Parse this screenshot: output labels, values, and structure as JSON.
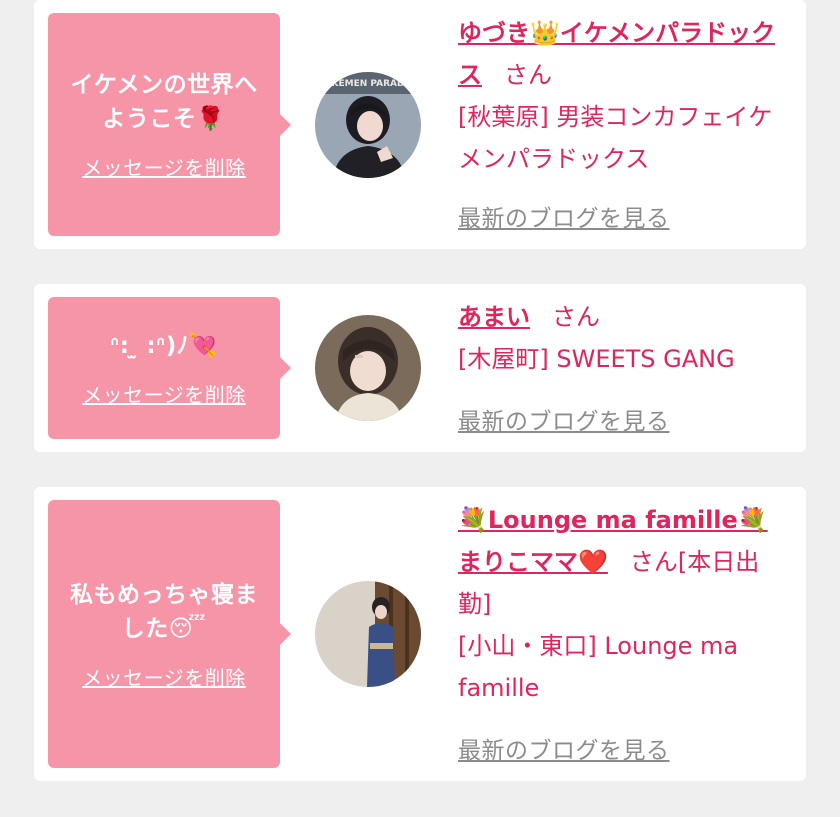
{
  "cards": [
    {
      "message": "イケメンの世界へようこそ🌹",
      "delete_label": "メッセージを削除",
      "name": "ゆづき👑イケメンパラドックス",
      "honorific": "さん",
      "shop": "[秋葉原] 男装コンカフェイケメンパラドックス",
      "blog_label": "最新のブログを見る",
      "avatar_text": "KEMEN PARAD"
    },
    {
      "message": "ᐢ: ̫ :ᐢ)ﾉ💘",
      "delete_label": "メッセージを削除",
      "name": "あまい",
      "honorific": "さん",
      "shop": "[木屋町] SWEETS GANG",
      "blog_label": "最新のブログを見る"
    },
    {
      "message": "私もめっちゃ寝ました😴",
      "delete_label": "メッセージを削除",
      "name": "💐Lounge ma famille💐まりこママ❤️",
      "honorific": "さん",
      "extra": "[本日出勤]",
      "shop": "[小山・東口] Lounge ma famille",
      "blog_label": "最新のブログを見る"
    }
  ]
}
